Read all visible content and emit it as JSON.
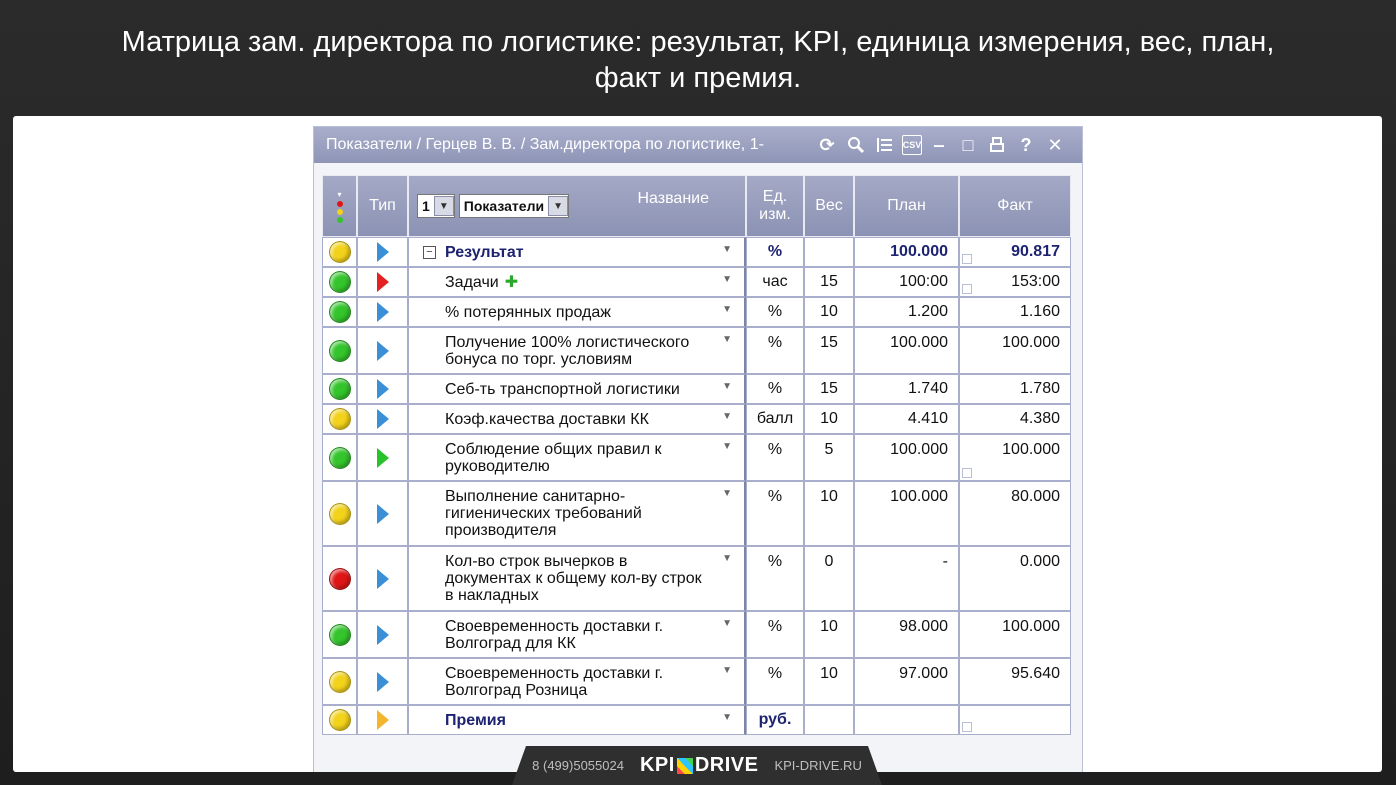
{
  "slide": {
    "title_line1": "Матрица зам. директора по логистике: результат, KPI, единица измерения, вес, план,",
    "title_line2": "факт и премия."
  },
  "window": {
    "title": "Показатели / Герцев В. В. / Зам.директора по логистике, 1-",
    "toolbar_icons": [
      "refresh-icon",
      "search-icon",
      "list-icon",
      "csv-icon",
      "minimize-icon",
      "maximize-icon",
      "print-icon",
      "help-icon",
      "close-icon"
    ],
    "toolbar_glyphs": {
      "csv": "CSV",
      "minimize": "‒",
      "maximize": "□",
      "help": "?",
      "close": "✕"
    }
  },
  "table": {
    "headers": {
      "type": "Тип",
      "level_select": "1",
      "view_select": "Показатели",
      "name": "Название",
      "unit_line1": "Ед.",
      "unit_line2": "изм.",
      "weight": "Вес",
      "plan": "План",
      "fact": "Факт"
    },
    "colors": {
      "yellow": "#f2d21a",
      "green": "#33c52b",
      "red": "#e01515",
      "header": "#9aa0c0"
    },
    "rows": [
      {
        "light": "yellow",
        "type": "blue",
        "name": "Результат",
        "unit": "%",
        "weight": "",
        "plan": "100.000",
        "fact": "90.817",
        "kind": "result"
      },
      {
        "light": "green",
        "type": "red",
        "name": "Задачи",
        "unit": "час",
        "weight": "15",
        "plan": "100:00",
        "fact": "153:00",
        "kind": "task"
      },
      {
        "light": "green",
        "type": "blue",
        "name": "% потерянных продаж",
        "unit": "%",
        "weight": "10",
        "plan": "1.200",
        "fact": "1.160"
      },
      {
        "light": "green",
        "type": "blue",
        "name": "Получение 100% логистического бонуса по торг. условиям",
        "unit": "%",
        "weight": "15",
        "plan": "100.000",
        "fact": "100.000"
      },
      {
        "light": "green",
        "type": "blue",
        "name": "Себ-ть транспортной логистики",
        "unit": "%",
        "weight": "15",
        "plan": "1.740",
        "fact": "1.780"
      },
      {
        "light": "yellow",
        "type": "blue",
        "name": "Коэф.качества доставки КК",
        "unit": "балл",
        "weight": "10",
        "plan": "4.410",
        "fact": "4.380"
      },
      {
        "light": "green",
        "type": "green",
        "name": "Соблюдение общих правил к руководителю",
        "unit": "%",
        "weight": "5",
        "plan": "100.000",
        "fact": "100.000"
      },
      {
        "light": "yellow",
        "type": "blue",
        "name": "Выполнение санитарно-гигиенических требований производителя",
        "unit": "%",
        "weight": "10",
        "plan": "100.000",
        "fact": "80.000"
      },
      {
        "light": "red",
        "type": "blue",
        "name": "Кол-во строк вычерков в документах к общему кол-ву строк в накладных",
        "unit": "%",
        "weight": "0",
        "plan": "-",
        "fact": "0.000"
      },
      {
        "light": "green",
        "type": "blue",
        "name": "Своевременность доставки г. Волгоград для КК",
        "unit": "%",
        "weight": "10",
        "plan": "98.000",
        "fact": "100.000"
      },
      {
        "light": "yellow",
        "type": "blue",
        "name": "Своевременность доставки г. Волгоград Розница",
        "unit": "%",
        "weight": "10",
        "plan": "97.000",
        "fact": "95.640"
      },
      {
        "light": "yellow",
        "type": "orange",
        "name": "Премия",
        "unit": "руб.",
        "weight": "",
        "plan": "",
        "fact": "",
        "kind": "bonus"
      }
    ]
  },
  "footer": {
    "phone": "8 (499)5055024",
    "logo_left": "KPI",
    "logo_right": "DRIVE",
    "site": "KPI-DRIVE.RU"
  }
}
